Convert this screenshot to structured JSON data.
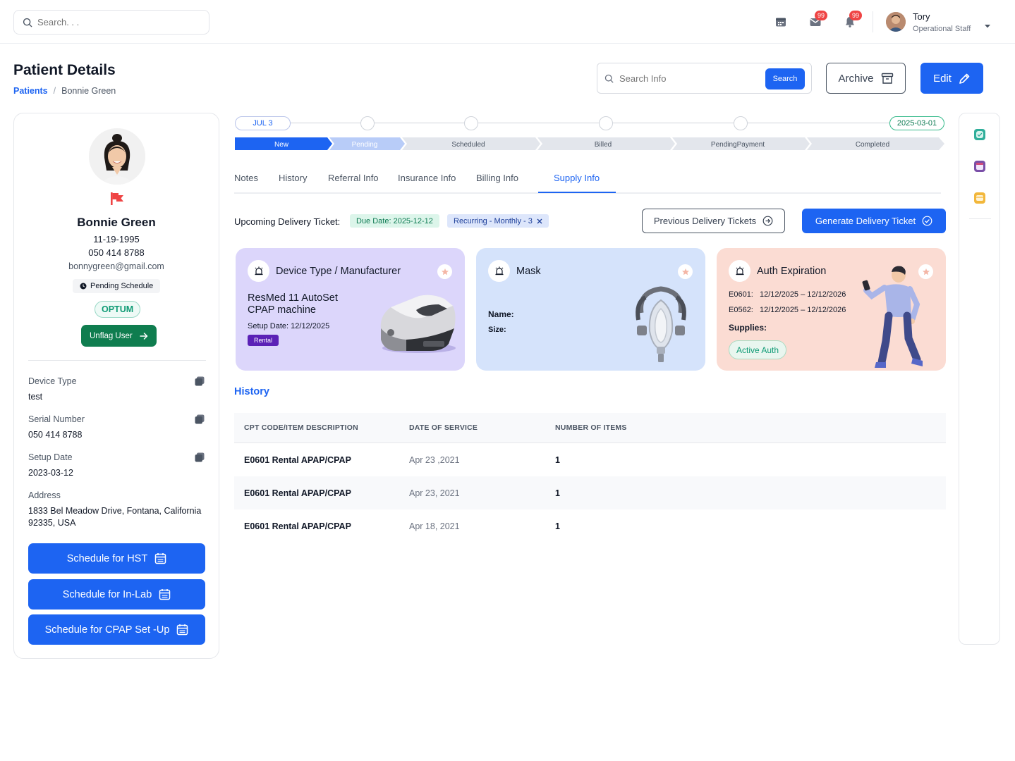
{
  "topbar": {
    "search_placeholder": "Search. . .",
    "mail_badge": "99",
    "bell_badge": "99",
    "user_name": "Tory",
    "user_role": "Operational Staff"
  },
  "header": {
    "title": "Patient Details",
    "breadcrumb_link": "Patients",
    "breadcrumb_sep": "/",
    "breadcrumb_current": "Bonnie Green",
    "info_search_placeholder": "Search Info",
    "info_search_btn": "Search",
    "archive_label": "Archive",
    "edit_label": "Edit"
  },
  "patient": {
    "name": "Bonnie Green",
    "dob": "11-19-1995",
    "phone": "050 414 8788",
    "email": "bonnygreen@gmail.com",
    "status": "Pending Schedule",
    "insurer": "OPTUM",
    "unflag_label": "Unflag User",
    "fields": [
      {
        "label": "Device Type",
        "value": "test"
      },
      {
        "label": "Serial Number",
        "value": "050 414 8788"
      },
      {
        "label": "Setup Date",
        "value": "2023-03-12"
      },
      {
        "label": "Address",
        "value": "1833 Bel Meadow Drive, Fontana, California 92335, USA"
      }
    ],
    "buttons": [
      "Schedule for HST",
      "Schedule for In-Lab",
      "Schedule for CPAP Set -Up"
    ]
  },
  "timeline": {
    "start": "JUL 3",
    "end": "2025-03-01",
    "stages": [
      "New",
      "Pending",
      "Scheduled",
      "Billed",
      "PendingPayment",
      "Completed"
    ],
    "active_stage": "New"
  },
  "tabs": [
    {
      "label": "Notes",
      "active": false
    },
    {
      "label": "History",
      "active": false
    },
    {
      "label": "Referral Info",
      "active": false
    },
    {
      "label": "Insurance Info",
      "active": false
    },
    {
      "label": "Billing Info",
      "active": false
    },
    {
      "label": "Supply Info",
      "active": true
    }
  ],
  "delivery": {
    "label": "Upcoming Delivery Ticket:",
    "due_chip": "Due Date: 2025-12-12",
    "recurring_chip": "Recurring - Monthly - 3",
    "prev_btn": "Previous Delivery Tickets",
    "gen_btn": "Generate Delivery Ticket"
  },
  "cards": {
    "device": {
      "title": "Device Type / Manufacturer",
      "model": "ResMed 11 AutoSet",
      "model2": "CPAP machine",
      "setup": "Setup Date: 12/12/2025",
      "tag": "Rental",
      "color": "#dcd6fb"
    },
    "mask": {
      "title": "Mask",
      "name_label": "Name:",
      "size_label": "Size:",
      "color": "#d5e3fb"
    },
    "auth": {
      "title": "Auth Expiration",
      "rows": [
        {
          "code": "E0601:",
          "range": "12/12/2025 – 12/12/2026"
        },
        {
          "code": "E0562:",
          "range": "12/12/2025 – 12/12/2026"
        }
      ],
      "supplies_label": "Supplies:",
      "active_chip": "Active Auth",
      "color": "#fbdcd3"
    }
  },
  "history": {
    "title": "History",
    "columns": [
      "CPT CODE/ITEM DESCRIPTION",
      "DATE OF SERVICE",
      "NUMBER OF ITEMS"
    ],
    "rows": [
      {
        "item": "E0601 Rental APAP/CPAP",
        "date": "Apr 23 ,2021",
        "count": "1"
      },
      {
        "item": "E0601 Rental APAP/CPAP",
        "date": "Apr 23, 2021",
        "count": "1"
      },
      {
        "item": "E0601 Rental APAP/CPAP",
        "date": "Apr 18, 2021",
        "count": "1"
      }
    ]
  },
  "colors": {
    "primary": "#1d64f2",
    "success": "#0f7d4f",
    "danger": "#ef4444"
  },
  "icons": [
    "search-icon",
    "calendar-icon",
    "mail-icon",
    "bell-icon",
    "chevron-down-icon",
    "archive-icon",
    "pencil-icon",
    "flag-icon",
    "clock-icon",
    "arrow-right-icon",
    "copy-icon",
    "close-icon",
    "arrow-circle-icon",
    "check-circle-icon",
    "alarm-icon",
    "star-icon"
  ]
}
